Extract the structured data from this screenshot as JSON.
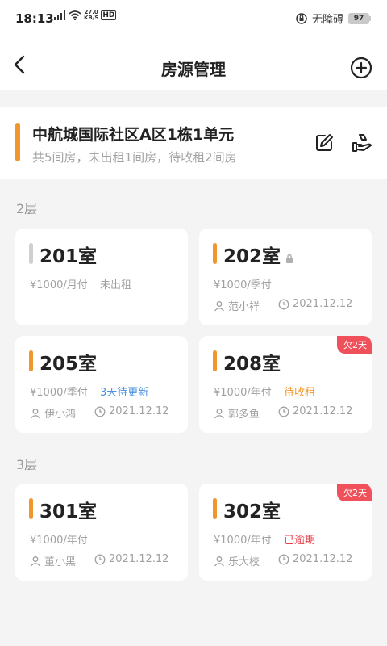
{
  "status_bar": {
    "time": "18:13",
    "net_speed_value": "27.0",
    "net_speed_unit": "KB/S",
    "hd": "HD",
    "accessibility": "无障碍",
    "battery": "97"
  },
  "nav": {
    "title": "房源管理"
  },
  "property": {
    "name": "中航城国际社区A区1栋1单元",
    "summary": "共5间房，未出租1间房，待收租2间房"
  },
  "floors": [
    {
      "label": "2层",
      "rooms": [
        {
          "name": "201室",
          "price": "¥1000/月付",
          "status": "未出租",
          "tenant": "",
          "date": "",
          "badge": ""
        },
        {
          "name": "202室",
          "price": "¥1000/季付",
          "status": "",
          "tenant": "范小祥",
          "date": "2021.12.12",
          "badge": ""
        },
        {
          "name": "205室",
          "price": "¥1000/季付",
          "status": "3天待更新",
          "tenant": "伊小鸿",
          "date": "2021.12.12",
          "badge": ""
        },
        {
          "name": "208室",
          "price": "¥1000/年付",
          "status": "待收租",
          "tenant": "郭多鱼",
          "date": "2021.12.12",
          "badge": "欠2天"
        }
      ]
    },
    {
      "label": "3层",
      "rooms": [
        {
          "name": "301室",
          "price": "¥1000/年付",
          "status": "",
          "tenant": "董小黑",
          "date": "2021.12.12",
          "badge": ""
        },
        {
          "name": "302室",
          "price": "¥1000/年付",
          "status": "已逾期",
          "tenant": "乐大校",
          "date": "2021.12.12",
          "badge": "欠2天"
        }
      ]
    }
  ],
  "colors": {
    "accent": "#f0962d",
    "status_blue": "#4a90e2",
    "status_red": "#e8414b",
    "badge": "#f0505a"
  }
}
